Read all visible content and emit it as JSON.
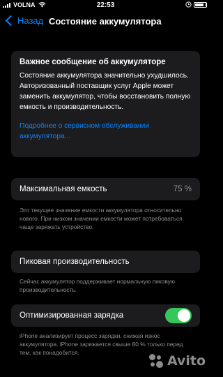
{
  "status_bar": {
    "carrier": "VOLNA",
    "time": "22:53",
    "battery_level": 0.8
  },
  "nav": {
    "back_label": "Назад",
    "title": "Состояние аккумулятора"
  },
  "warning": {
    "title": "Важное сообщение об аккумуляторе",
    "body": "Состояние аккумулятора значительно ухудшилось. Авторизованный поставщик услуг Apple может заменить аккумулятор, чтобы восстановить полную емкость и производительность.",
    "link": "Подробнее о сервисном обслуживании аккумулятора..."
  },
  "max_capacity": {
    "label": "Максимальная емкость",
    "value": "75 %",
    "footnote": "Это текущее значение емкости аккумулятора относительно нового. При низком значении емкости может потребоваться чаще заряжать устройство."
  },
  "peak_performance": {
    "label": "Пиковая производительность",
    "footnote": "Сейчас аккумулятор поддерживает нормальную пиковую производительность."
  },
  "optimized_charging": {
    "label": "Оптимизированная зарядка",
    "enabled": true,
    "toggle_color": "#34c759",
    "footnote": "iPhone анализирует процесс зарядки, снижая износ аккумулятора. iPhone заряжается свыше 80 % только перед тем, как понадобится."
  },
  "watermark": {
    "text": "Avito"
  },
  "colors": {
    "accent": "#0a84ff",
    "background": "#000000",
    "card": "#1c1c1e",
    "secondary_text": "#8e8e93"
  }
}
